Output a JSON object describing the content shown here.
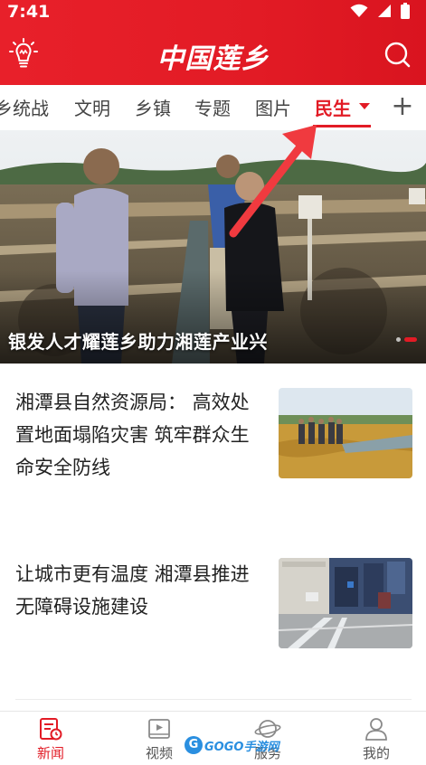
{
  "status_bar": {
    "time": "7:41"
  },
  "header": {
    "brand": "中国莲乡"
  },
  "tabs": {
    "items": [
      {
        "label": "乡统战"
      },
      {
        "label": "文明"
      },
      {
        "label": "乡镇"
      },
      {
        "label": "专题"
      },
      {
        "label": "图片"
      },
      {
        "label": "民生"
      }
    ],
    "active": "民生",
    "add_label": "+"
  },
  "hero": {
    "caption": "银发人才耀莲乡助力湘莲产业兴"
  },
  "news": [
    {
      "title": "湘潭县自然资源局： 高效处置地面塌陷灾害 筑牢群众生命安全防线"
    },
    {
      "title": "让城市更有温度 湘潭县推进无障碍设施建设"
    }
  ],
  "bottom_nav": [
    {
      "label": "新闻"
    },
    {
      "label": "视频"
    },
    {
      "label": "服务"
    },
    {
      "label": "我的"
    }
  ],
  "watermark": {
    "text": "GOGO手游网"
  },
  "colors": {
    "accent": "#e21b25"
  }
}
